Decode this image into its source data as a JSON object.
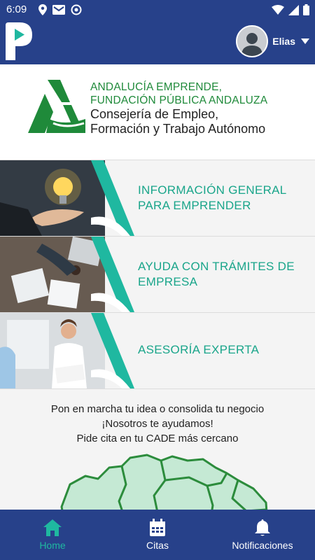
{
  "status_bar": {
    "time": "6:09"
  },
  "app_bar": {
    "user_name": "Elias"
  },
  "brand": {
    "line1": "ANDALUCÍA EMPRENDE,",
    "line2": "FUNDACIÓN PÚBLICA ANDALUZA",
    "line3": "Consejería de Empleo,",
    "line4": "Formación y Trabajo Autónomo"
  },
  "cards": [
    {
      "line1": "INFORMACIÓN GENERAL",
      "line2": "PARA EMPRENDER"
    },
    {
      "line1": "AYUDA CON TRÁMITES DE",
      "line2": "EMPRESA"
    },
    {
      "line1": "ASESORÍA EXPERTA",
      "line2": ""
    }
  ],
  "promo": {
    "line1": "Pon en marcha tu idea o consolida tu negocio",
    "line2": "¡Nosotros te ayudamos!",
    "line3": "Pide cita en tu CADE más cercano"
  },
  "bottom_nav": {
    "items": [
      {
        "label": "Home",
        "icon": "home-icon",
        "active": true
      },
      {
        "label": "Citas",
        "icon": "calendar-icon",
        "active": false
      },
      {
        "label": "Notificaciones",
        "icon": "bell-icon",
        "active": false
      }
    ]
  },
  "colors": {
    "primary": "#27418a",
    "accent_teal": "#1fb8a0",
    "brand_green": "#1f8a3a"
  }
}
